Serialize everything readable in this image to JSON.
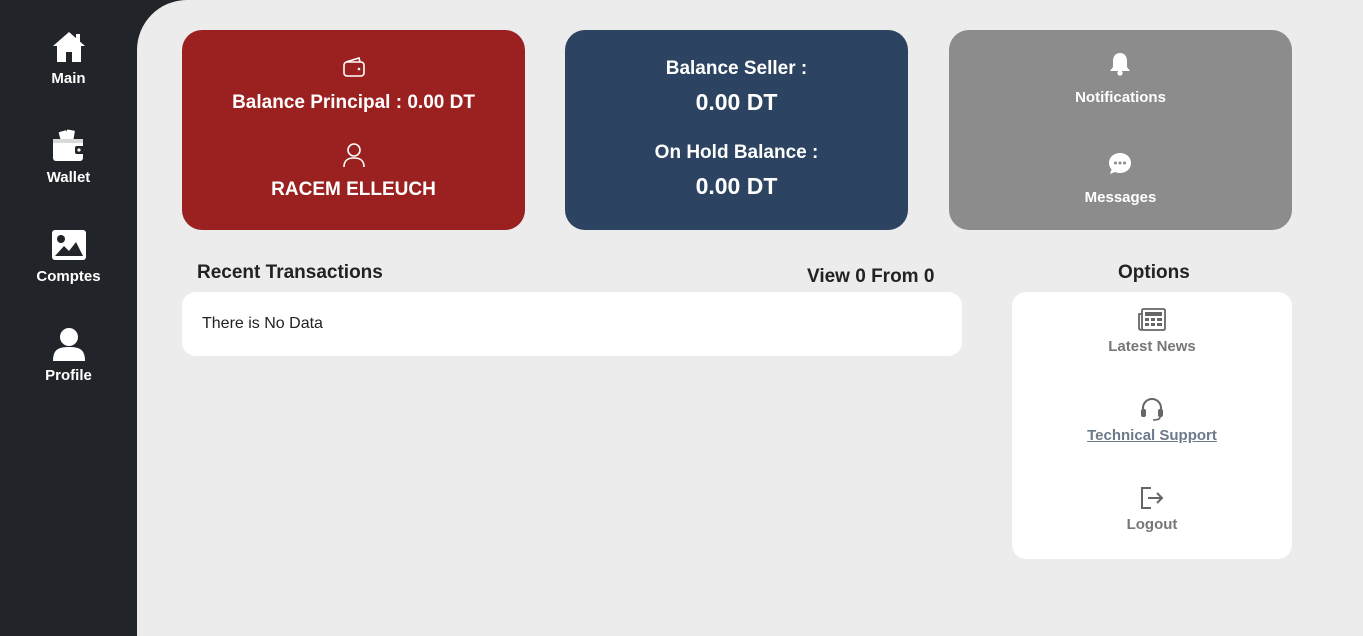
{
  "sidebar": {
    "items": [
      {
        "label": "Main",
        "icon": "home-icon"
      },
      {
        "label": "Wallet",
        "icon": "wallet-icon"
      },
      {
        "label": "Comptes",
        "icon": "image-icon"
      },
      {
        "label": "Profile",
        "icon": "user-icon"
      }
    ]
  },
  "cards": {
    "principal": {
      "balance_text": "Balance Principal : 0.00 DT",
      "user_name": "RACEM ELLEUCH",
      "color": "#9b2121"
    },
    "seller": {
      "balance_label": "Balance Seller :",
      "balance_value": "0.00 DT",
      "hold_label": "On Hold Balance :",
      "hold_value": "0.00 DT",
      "color": "#2c4361"
    },
    "alerts": {
      "notifications_label": "Notifications",
      "messages_label": "Messages",
      "color": "#8c8c8c"
    }
  },
  "transactions": {
    "title": "Recent Transactions",
    "pagination": "View 0 From 0",
    "empty_text": "There is No Data"
  },
  "options": {
    "title": "Options",
    "items": [
      {
        "label": "Latest News",
        "icon": "newspaper-icon"
      },
      {
        "label": "Technical Support",
        "icon": "headset-icon"
      },
      {
        "label": "Logout",
        "icon": "logout-icon"
      }
    ]
  }
}
